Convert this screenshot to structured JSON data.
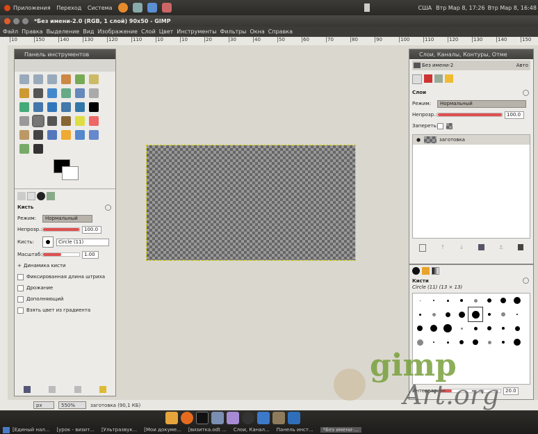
{
  "topbar": {
    "menus": [
      "Приложения",
      "Переход",
      "Система"
    ],
    "indicator": "США",
    "clock": "Втр Мар 8, 17:26",
    "clock2": "Втр Мар 8, 16:48"
  },
  "window": {
    "title": "*Без имени-2.0 (RGB, 1 слой) 90x50 - GIMP"
  },
  "menubar": [
    "Файл",
    "Правка",
    "Выделение",
    "Вид",
    "Изображение",
    "Слой",
    "Цвет",
    "Инструменты",
    "Фильтры",
    "Окна",
    "Справка"
  ],
  "ruler": {
    "ticks": [
      "10",
      "150",
      "140",
      "130",
      "120",
      "110",
      "10",
      "10",
      "20",
      "30",
      "40",
      "50",
      "60",
      "70",
      "80",
      "90",
      "100",
      "110",
      "120",
      "130",
      "140",
      "150",
      "160"
    ]
  },
  "toolbox": {
    "title": "Панель инструментов",
    "brush_title": "Кисть",
    "mode_label": "Режим:",
    "mode_value": "Нормальный",
    "opacity_label": "Непрозр.:",
    "opacity_value": "100.0",
    "opacity_percent": 100,
    "brush_label": "Кисть:",
    "brush_value": "Circle (11)",
    "scale_label": "Масштаб:",
    "scale_value": "1.00",
    "scale_fraction": 0.5,
    "dynamics": "Динамика кисти",
    "options": [
      "Фиксированная длина штриха",
      "Дрожание",
      "Дополняющий",
      "Взять цвет из градиента"
    ]
  },
  "layers": {
    "title": "Слои, Каналы, Контуры, Отме",
    "image_name": "Без имени-2",
    "auto": "Авто",
    "section": "Слои",
    "mode_label": "Режим:",
    "mode_value": "Нормальный",
    "opacity_label": "Непрозр.:",
    "opacity_value": "100.0",
    "opacity_percent": 100,
    "lock_label": "Запереть:",
    "layer_name": "заготовка"
  },
  "brushes": {
    "title": "Кисти",
    "current": "Circle (11) (13 × 13)",
    "interval_label": "Интервал:",
    "interval_value": "20.0",
    "interval_fraction": 0.2
  },
  "statusbar": {
    "unit": "px",
    "zoom": "550%",
    "layer_info": "заготовка (90,1 КБ)"
  },
  "taskbar": {
    "items": [
      "[Единый нал...",
      "[урок - визит...",
      "[Ультразвук...",
      "[Мои докуме...",
      "[визитка.odt ...",
      "Слои, Канал...",
      "Панель инст...",
      "*Без имени-..."
    ]
  },
  "watermark": {
    "line1": "gimp",
    "line2": "Art.org"
  }
}
